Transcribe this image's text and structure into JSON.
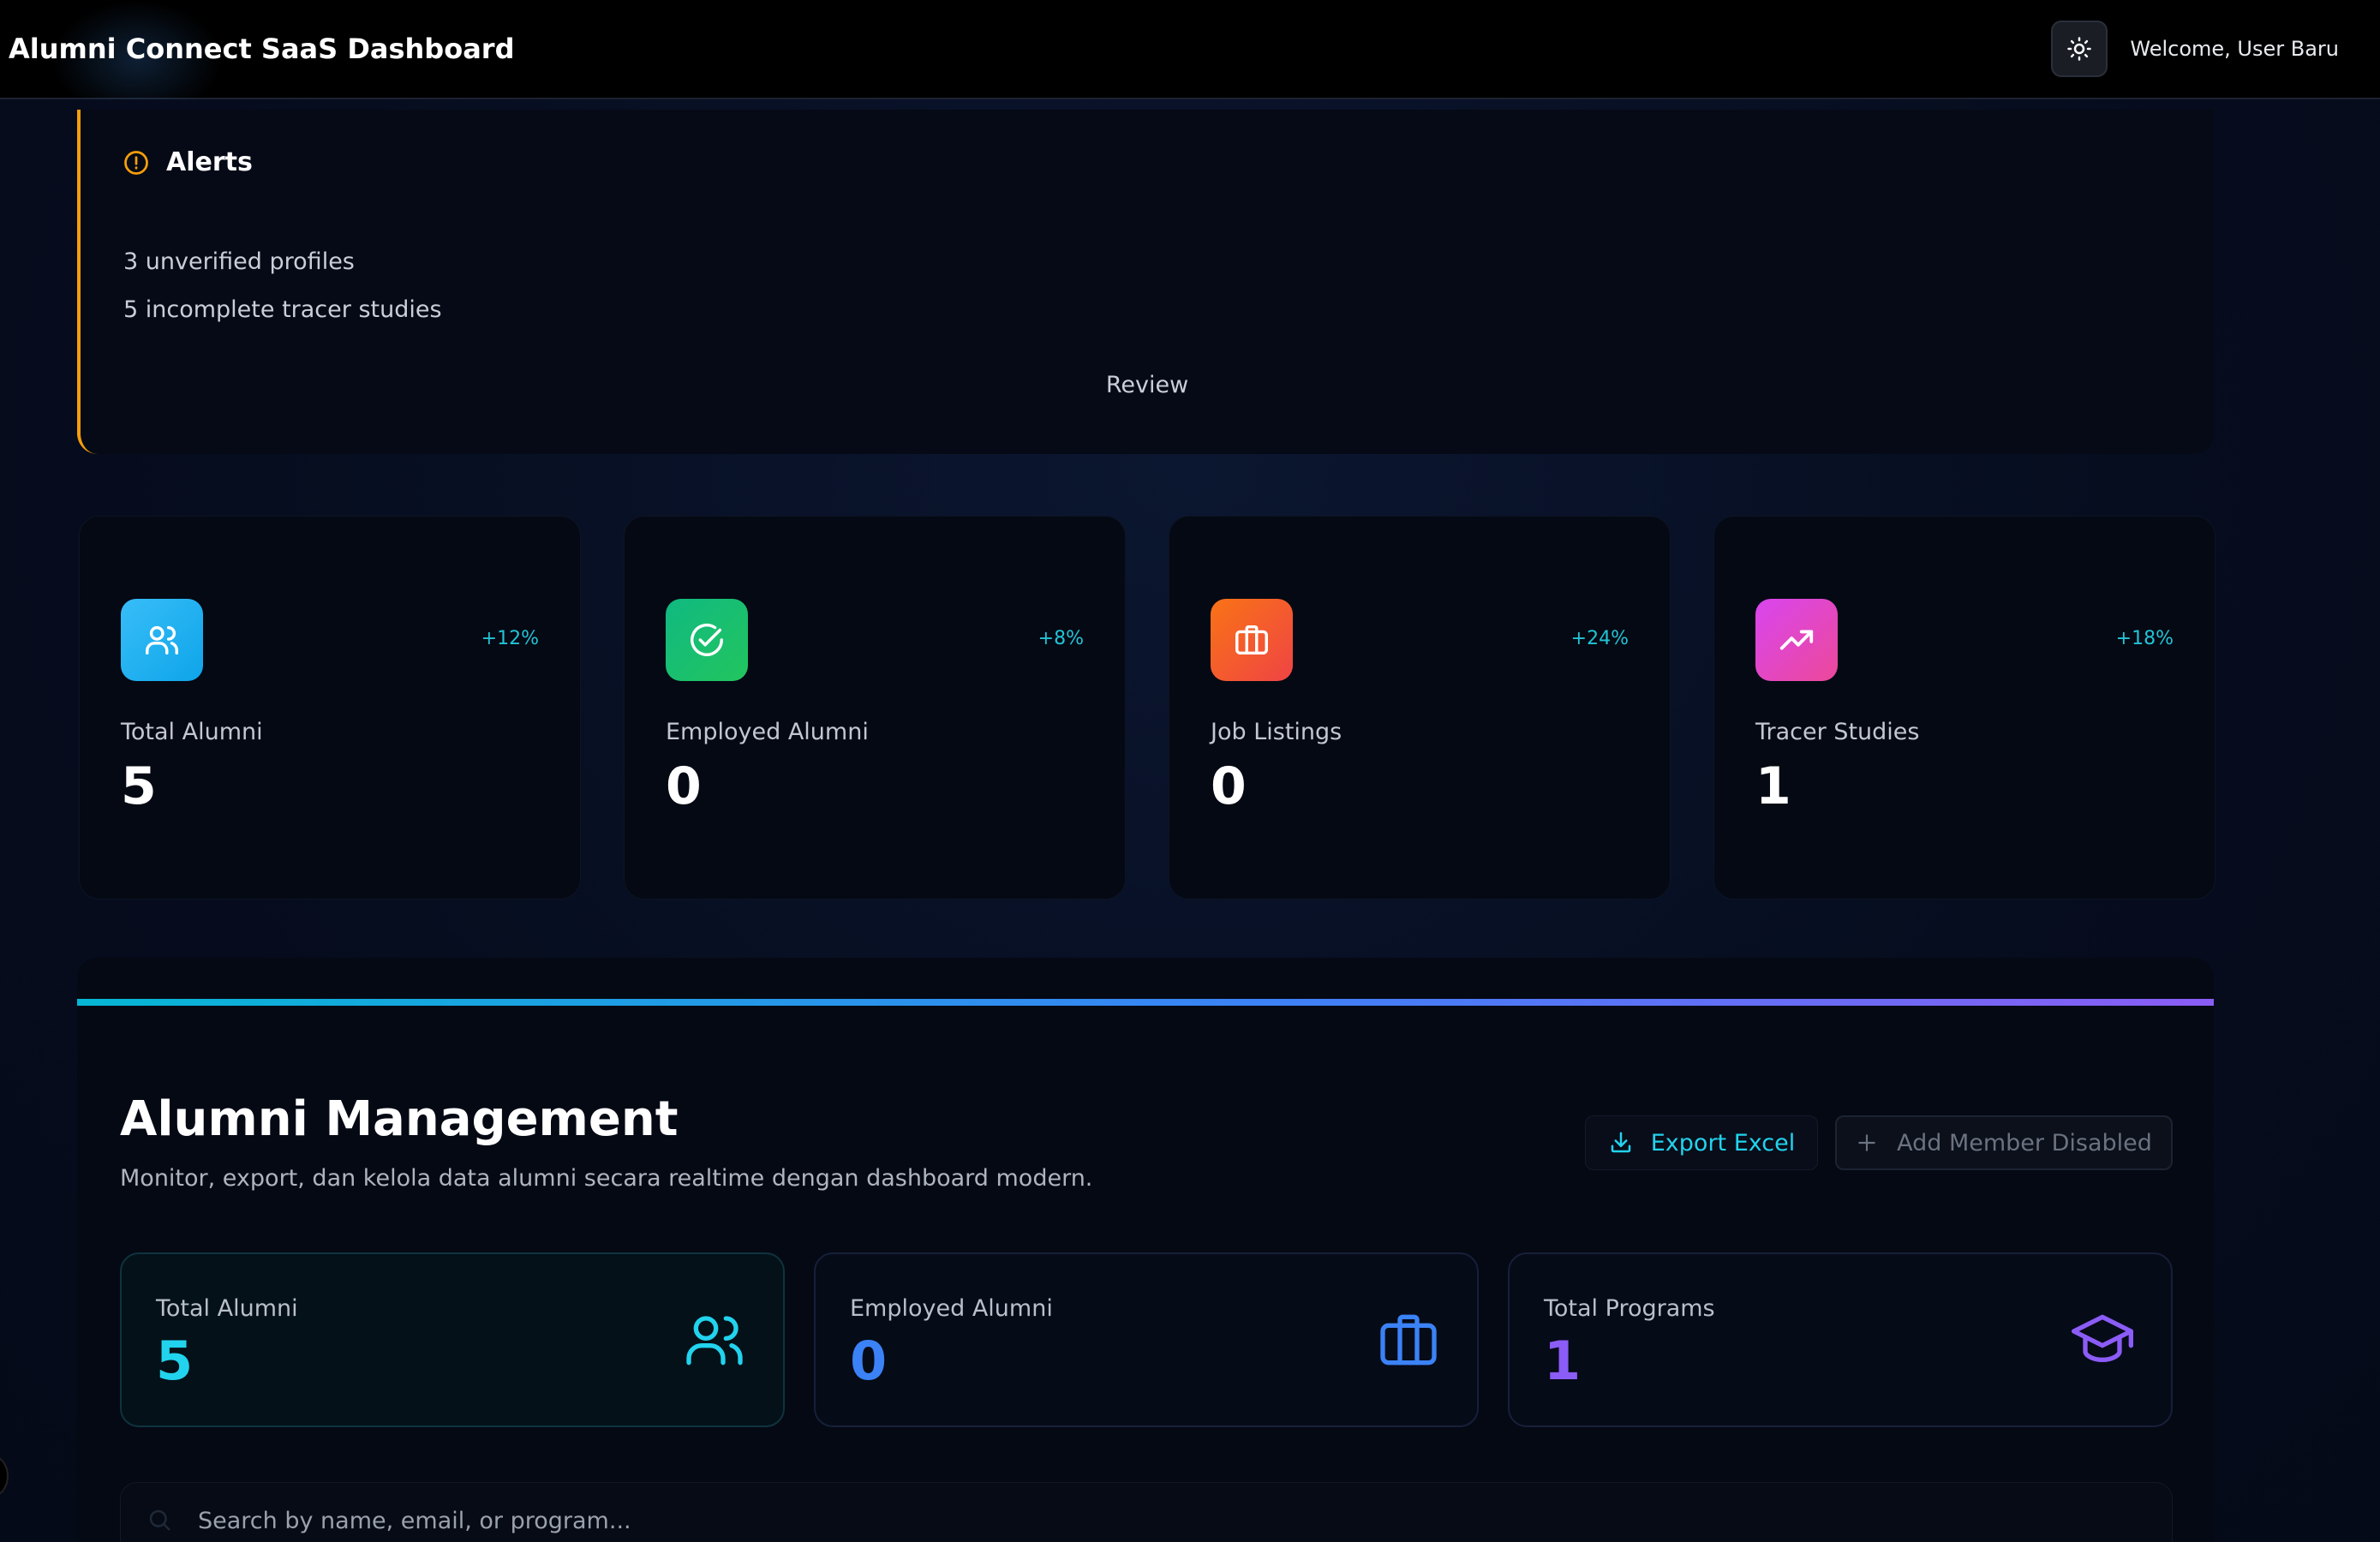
{
  "header": {
    "title": "Alumni Connect SaaS Dashboard",
    "welcome": "Welcome, User Baru",
    "theme_icon": "sun-icon"
  },
  "alerts": {
    "title": "Alerts",
    "items": [
      "3 unverified profiles",
      "5 incomplete tracer studies"
    ],
    "action": "Review",
    "accent_color": "#f59e0b"
  },
  "stats": [
    {
      "label": "Total Alumni",
      "value": "5",
      "delta": "+12%",
      "icon": "users-icon",
      "gradient": [
        "#38bdf8",
        "#0ea5e9"
      ]
    },
    {
      "label": "Employed Alumni",
      "value": "0",
      "delta": "+8%",
      "icon": "check-circle-icon",
      "gradient": [
        "#10b981",
        "#22c55e"
      ]
    },
    {
      "label": "Job Listings",
      "value": "0",
      "delta": "+24%",
      "icon": "briefcase-icon",
      "gradient": [
        "#f97316",
        "#ef4444"
      ]
    },
    {
      "label": "Tracer Studies",
      "value": "1",
      "delta": "+18%",
      "icon": "trending-up-icon",
      "gradient": [
        "#d946ef",
        "#ec4899"
      ]
    }
  ],
  "management": {
    "title": "Alumni Management",
    "subtitle": "Monitor, export, dan kelola data alumni secara realtime dengan dashboard modern.",
    "export_label": "Export Excel",
    "add_label": "Add Member Disabled",
    "cards": [
      {
        "label": "Total Alumni",
        "value": "5",
        "color": "#22d3ee",
        "icon": "users-icon"
      },
      {
        "label": "Employed Alumni",
        "value": "0",
        "color": "#3b82f6",
        "icon": "briefcase-icon"
      },
      {
        "label": "Total Programs",
        "value": "1",
        "color": "#8b5cf6",
        "icon": "graduation-cap-icon"
      }
    ],
    "search_placeholder": "Search by name, email, or program..."
  }
}
